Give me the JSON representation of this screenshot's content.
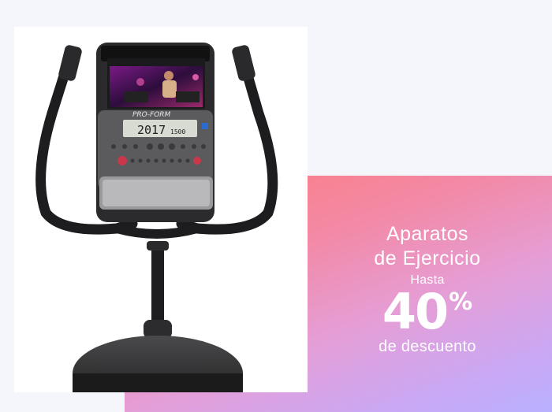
{
  "promo": {
    "title_line1": "Aparatos",
    "title_line2": "de Ejercicio",
    "upto": "Hasta",
    "discount_value": "40",
    "discount_unit": "%",
    "subtitle": "de descuento"
  },
  "product": {
    "brand": "PRO-FORM",
    "console_reading_main": "2017",
    "console_reading_small": "1500",
    "image_subject": "stationary-exercise-bike"
  },
  "colors": {
    "accent_gradient_start": "#ff7a7a",
    "accent_gradient_end": "#b9b1ff",
    "background": "#f5f6fb",
    "text": "#ffffff"
  }
}
